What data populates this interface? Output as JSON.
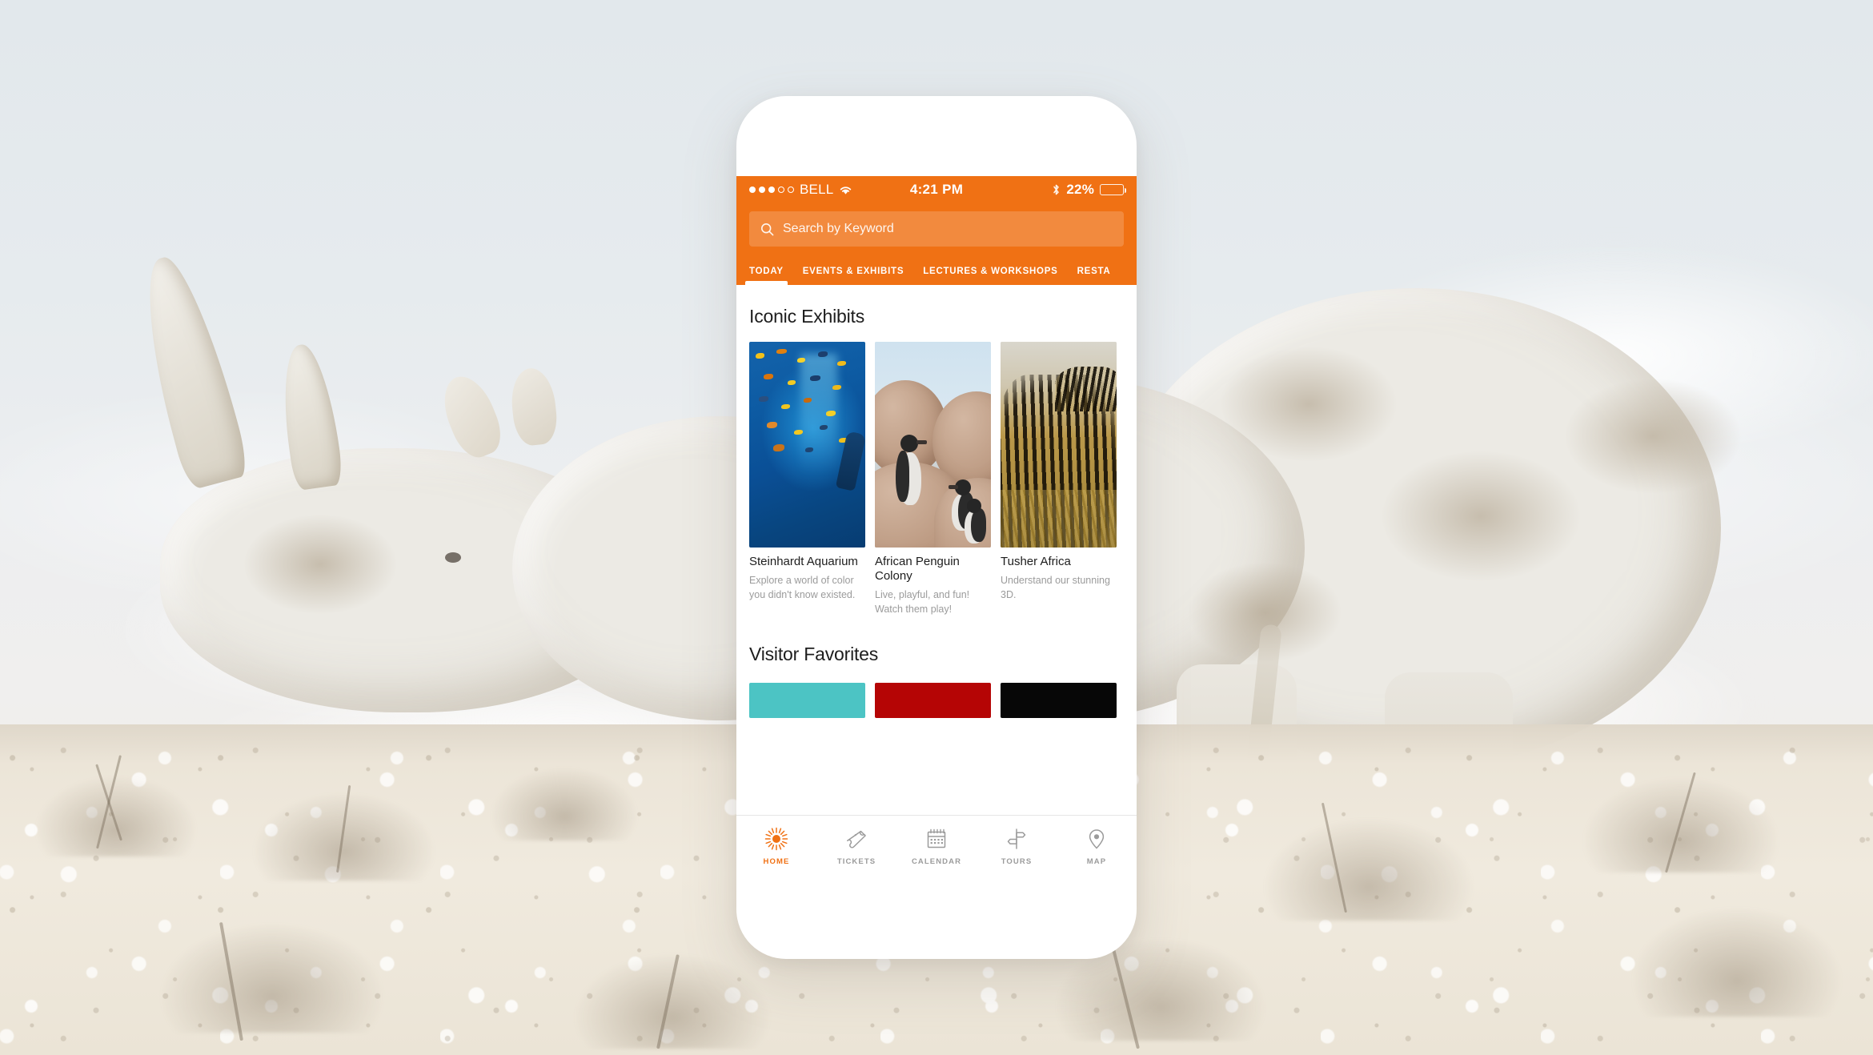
{
  "scene": {
    "description": "Mobile museum/zoo app mockup on a white smartphone composited over a pale desert photograph of a white rhinoceros"
  },
  "background": {
    "subject": "white rhinoceros standing on pale cracked desert ground",
    "sky_color": "#e6ebee",
    "ground_color": "#ece5d8",
    "animal_color": "#eceae4"
  },
  "phone": {
    "frame_color": "#ffffff",
    "accent_color": "#F07114"
  },
  "statusbar": {
    "carrier": "BELL",
    "signal_dots_filled": 3,
    "signal_dots_total": 5,
    "wifi_icon": "wifi-icon",
    "time": "4:21 PM",
    "bluetooth_icon": "bluetooth-icon",
    "battery_percent": "22%",
    "battery_level": 22
  },
  "search": {
    "icon": "search-icon",
    "placeholder": "Search by Keyword",
    "value": ""
  },
  "nav_tabs": [
    {
      "label": "TODAY",
      "active": true
    },
    {
      "label": "EVENTS & EXHIBITS",
      "active": false
    },
    {
      "label": "LECTURES & WORKSHOPS",
      "active": false
    },
    {
      "label": "RESTA",
      "active": false
    }
  ],
  "sections": [
    {
      "title": "Iconic Exhibits",
      "cards": [
        {
          "title": "Steinhardt Aquarium",
          "description": "Explore a world of color you didn't know existed.",
          "image": "underwater-aquarium-photo"
        },
        {
          "title": "African Penguin Colony",
          "description": "Live, playful, and fun! Watch them play!",
          "image": "penguins-on-rocks-photo"
        },
        {
          "title": "Tusher Africa",
          "description": "Understand our stunning 3D.",
          "image": "zebras-in-savanna-photo"
        }
      ]
    },
    {
      "title": "Visitor Favorites",
      "cards": [
        {
          "color": "#4CC4C4"
        },
        {
          "color": "#B50505"
        },
        {
          "color": "#070707"
        }
      ]
    }
  ],
  "tabbar": [
    {
      "label": "HOME",
      "icon": "sun-icon",
      "active": true
    },
    {
      "label": "TICKETS",
      "icon": "ticket-icon",
      "active": false
    },
    {
      "label": "CALENDAR",
      "icon": "calendar-icon",
      "active": false
    },
    {
      "label": "TOURS",
      "icon": "signpost-icon",
      "active": false
    },
    {
      "label": "MAP",
      "icon": "map-pin-icon",
      "active": false
    }
  ],
  "colors": {
    "accent": "#F07114",
    "muted_text": "#9b9b9b",
    "dark_text": "#1d1d1d"
  }
}
